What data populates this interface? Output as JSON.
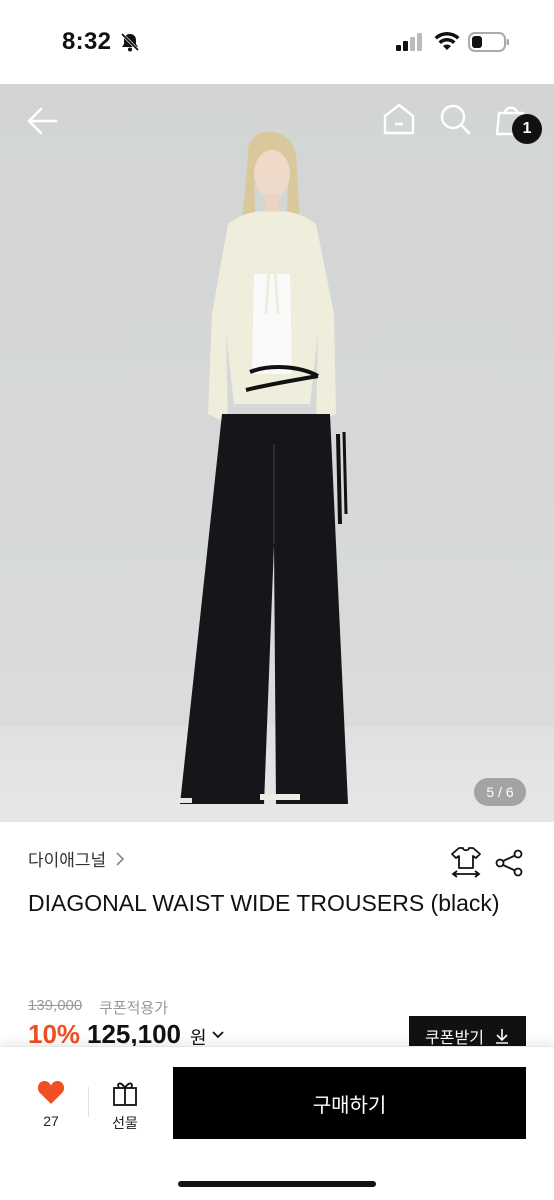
{
  "status_bar": {
    "time": "8:32"
  },
  "hero": {
    "image_counter": "5 / 6",
    "cart_count": "1"
  },
  "product": {
    "brand": "다이애그널",
    "title": "DIAGONAL WAIST WIDE TROUSERS (black)",
    "original_price": "139,000",
    "coupon_label": "쿠폰적용가",
    "discount": "10%",
    "sale_price": "125,100",
    "currency": "원",
    "coupon_button": "쿠폰받기"
  },
  "bottom_bar": {
    "like_count": "27",
    "gift_label": "선물",
    "buy_label": "구매하기"
  },
  "colors": {
    "discount": "#f04e23",
    "heart": "#f04e23",
    "primary": "#000000"
  }
}
